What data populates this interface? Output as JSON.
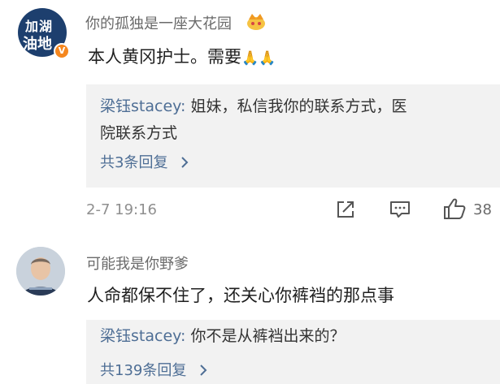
{
  "comments": [
    {
      "username": "你的孤独是一座大花园",
      "avatar_text": [
        "加湖",
        "油地"
      ],
      "verified_badge": "V",
      "text_main": "本人黄冈护士。需要",
      "text_emoji": "🙏🙏",
      "reply": {
        "author": "梁钰stacey:",
        "text_line1": " 姐妹，私信我你的联系方式，医",
        "text_line2": "院联系方式",
        "count_label": "共3条回复"
      },
      "time": "2-7 19:16",
      "likes": "38"
    },
    {
      "username": "可能我是你野爹",
      "text_main": "人命都保不住了，还关心你裤裆的那点事",
      "reply": {
        "author": "梁钰stacey:",
        "text_line1": " 你不是从裤裆出来的？",
        "count_label": "共139条回复"
      }
    }
  ],
  "icons": {
    "crown_badge": "crown-icon",
    "chevron": "chevron-right-icon",
    "share": "share-icon",
    "comment": "comment-icon",
    "like": "like-icon"
  },
  "colors": {
    "link_blue": "#4e6e95",
    "reply_bg": "#f2f2f2",
    "avatar1_bg": "#1d3f6e",
    "badge_orange": "#f5871f"
  }
}
